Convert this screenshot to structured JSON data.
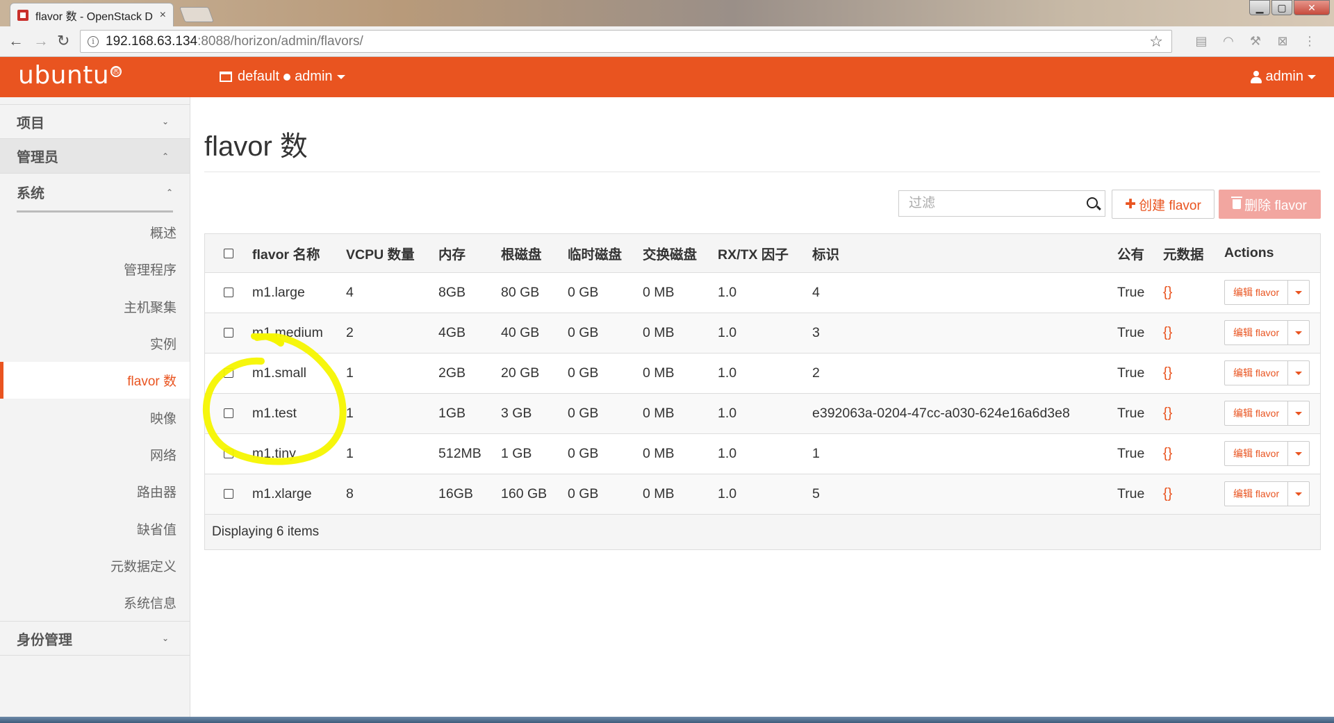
{
  "browser": {
    "tab_title": "flavor 数 - OpenStack D",
    "tab_close": "×",
    "url_host": "192.168.63.134",
    "url_rest": ":8088/horizon/admin/flavors/",
    "back": "←",
    "forward": "→",
    "reload": "↻",
    "star": "☆",
    "info": "i",
    "win_min": "▁",
    "win_max": "▢",
    "win_close": "✕"
  },
  "topnav": {
    "brand": "ubuntu",
    "brand_mark": "®",
    "project": "default",
    "project_user": "admin",
    "user": "admin"
  },
  "sidebar": {
    "project": "项目",
    "admin": "管理员",
    "system": "系统",
    "items": [
      "概述",
      "管理程序",
      "主机聚集",
      "实例",
      "flavor 数",
      "映像",
      "网络",
      "路由器",
      "缺省值",
      "元数据定义",
      "系统信息"
    ],
    "active_index": 4,
    "identity": "身份管理",
    "chev_down": "⌄",
    "chev_up": "⌃"
  },
  "main": {
    "title": "flavor 数",
    "filter_placeholder": "过滤",
    "create_label": "创建 flavor",
    "delete_label": "删除 flavor"
  },
  "table": {
    "headers": [
      "flavor 名称",
      "VCPU 数量",
      "内存",
      "根磁盘",
      "临时磁盘",
      "交换磁盘",
      "RX/TX 因子",
      "标识",
      "公有",
      "元数据",
      "Actions"
    ],
    "rows": [
      {
        "name": "m1.large",
        "vcpus": "4",
        "ram": "8GB",
        "root": "80 GB",
        "ephemeral": "0 GB",
        "swap": "0 MB",
        "rxtx": "1.0",
        "id": "4",
        "public": "True",
        "metadata": "{}",
        "action": "编辑 flavor"
      },
      {
        "name": "m1.medium",
        "vcpus": "2",
        "ram": "4GB",
        "root": "40 GB",
        "ephemeral": "0 GB",
        "swap": "0 MB",
        "rxtx": "1.0",
        "id": "3",
        "public": "True",
        "metadata": "{}",
        "action": "编辑 flavor"
      },
      {
        "name": "m1.small",
        "vcpus": "1",
        "ram": "2GB",
        "root": "20 GB",
        "ephemeral": "0 GB",
        "swap": "0 MB",
        "rxtx": "1.0",
        "id": "2",
        "public": "True",
        "metadata": "{}",
        "action": "编辑 flavor"
      },
      {
        "name": "m1.test",
        "vcpus": "1",
        "ram": "1GB",
        "root": "3 GB",
        "ephemeral": "0 GB",
        "swap": "0 MB",
        "rxtx": "1.0",
        "id": "e392063a-0204-47cc-a030-624e16a6d3e8",
        "public": "True",
        "metadata": "{}",
        "action": "编辑 flavor"
      },
      {
        "name": "m1.tiny",
        "vcpus": "1",
        "ram": "512MB",
        "root": "1 GB",
        "ephemeral": "0 GB",
        "swap": "0 MB",
        "rxtx": "1.0",
        "id": "1",
        "public": "True",
        "metadata": "{}",
        "action": "编辑 flavor"
      },
      {
        "name": "m1.xlarge",
        "vcpus": "8",
        "ram": "16GB",
        "root": "160 GB",
        "ephemeral": "0 GB",
        "swap": "0 MB",
        "rxtx": "1.0",
        "id": "5",
        "public": "True",
        "metadata": "{}",
        "action": "编辑 flavor"
      }
    ],
    "footer": "Displaying 6 items"
  },
  "colors": {
    "accent": "#e95420",
    "delete_disabled": "#f2a6a0",
    "annotation": "#f5f500"
  }
}
